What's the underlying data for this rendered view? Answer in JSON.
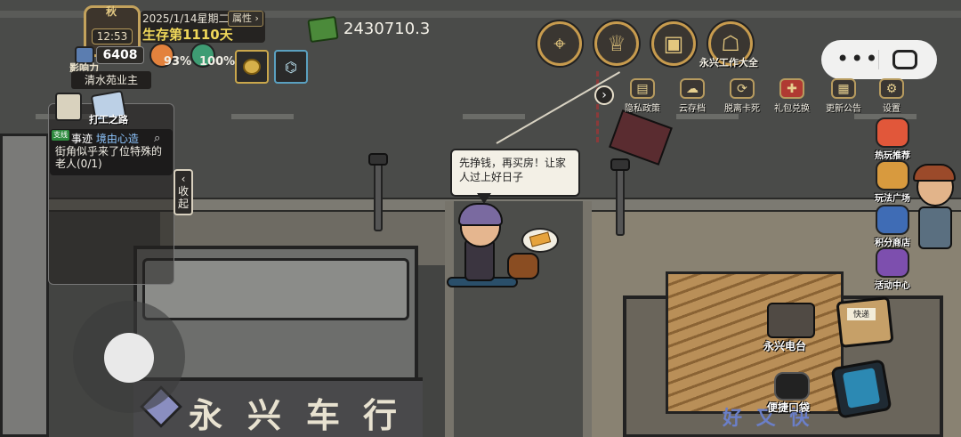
{
  "hud": {
    "avatar_badge": "秋",
    "time": "12:53",
    "date": "2025/1/14星期二",
    "survival": "生存第1110天",
    "attr_button": "属性",
    "influence_label": "影响力",
    "influence_value": "6408",
    "stat1_value": "93%",
    "stat2_value": "100%",
    "title": "清水苑业主",
    "money": "2430710.3"
  },
  "top_buttons": {
    "yx_job_label": "永兴工作大全"
  },
  "mini_menu": {
    "items": [
      {
        "label": "隐私政策",
        "icon": "policy-icon"
      },
      {
        "label": "云存档",
        "icon": "cloud-icon"
      },
      {
        "label": "脱离卡死",
        "icon": "unstuck-icon"
      },
      {
        "label": "礼包兑换",
        "icon": "gift-icon"
      },
      {
        "label": "更新公告",
        "icon": "notice-icon"
      },
      {
        "label": "设置",
        "icon": "gear-icon"
      }
    ]
  },
  "side_menu": {
    "items": [
      {
        "label": "热玩推荐",
        "color": "#e1573a"
      },
      {
        "label": "玩法广场",
        "color": "#d89a3e"
      },
      {
        "label": "积分商店",
        "color": "#3f6cb5"
      },
      {
        "label": "活动中心",
        "color": "#7d4fae"
      }
    ]
  },
  "quest": {
    "tab_label": "打工之路",
    "tag": "支线",
    "title_prefix": "事迹 ",
    "title_link": "境由心造",
    "desc": "街角似乎来了位特殊的老人(0/1)",
    "collapse": "收起"
  },
  "dialog": {
    "speech": "先挣钱，再买房！让家人过上好日子"
  },
  "scene": {
    "sign_chars": [
      "永",
      "兴",
      "车",
      "行"
    ],
    "banner": "好 又 快"
  },
  "bottom_right": {
    "radio_label": "永兴电台",
    "box_label": "快递",
    "pocket_label": "便捷口袋"
  }
}
